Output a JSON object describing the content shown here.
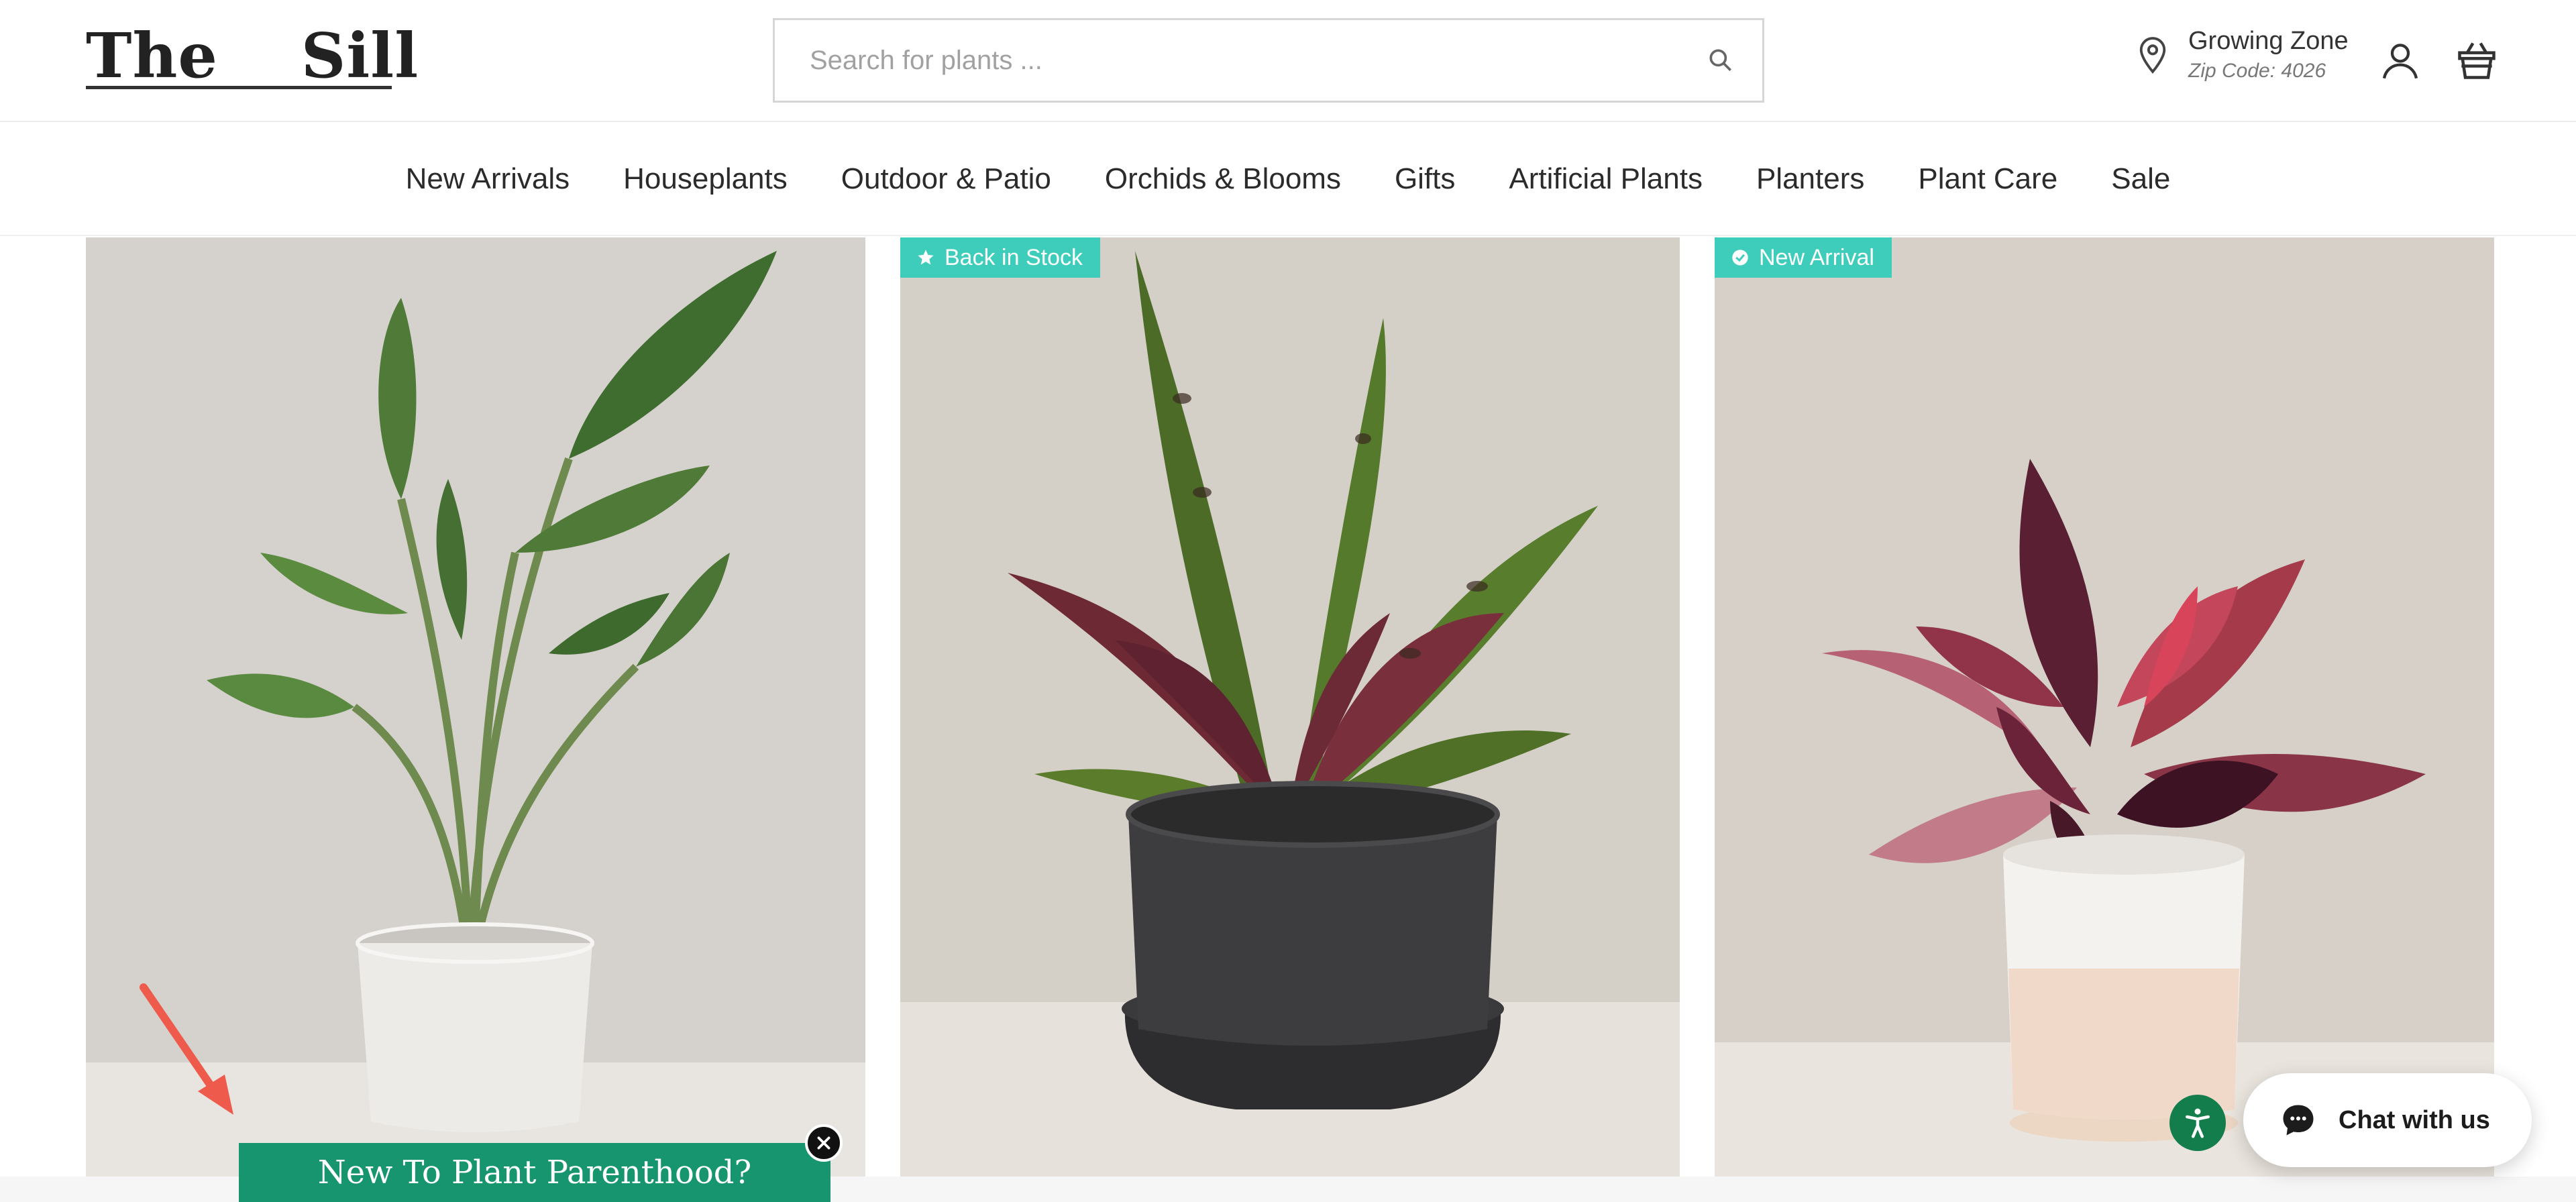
{
  "header": {
    "logo_left": "The",
    "logo_right": "Sill",
    "search_placeholder": "Search for plants ...",
    "zone_title": "Growing Zone",
    "zone_zip": "Zip Code: 4026"
  },
  "nav": {
    "items": [
      {
        "label": "New Arrivals"
      },
      {
        "label": "Houseplants"
      },
      {
        "label": "Outdoor & Patio"
      },
      {
        "label": "Orchids & Blooms"
      },
      {
        "label": "Gifts"
      },
      {
        "label": "Artificial Plants"
      },
      {
        "label": "Planters"
      },
      {
        "label": "Plant Care"
      },
      {
        "label": "Sale"
      }
    ]
  },
  "products": [
    {
      "badge": null,
      "pot_color": "#ecebe8",
      "wall_color": "#d5d2cd"
    },
    {
      "badge": "Back in Stock",
      "pot_color": "#3d3d3f",
      "wall_color": "#d4cfc7"
    },
    {
      "badge": "New Arrival",
      "pot_color": "#f4f2ef",
      "wall_color": "#d6d0c9"
    }
  ],
  "popup": {
    "label": "New To Plant Parenthood?"
  },
  "chat": {
    "label": "Chat with us"
  },
  "colors": {
    "badge": "#3ecdbb",
    "popup": "#17956f",
    "a11y": "#137d4c",
    "arrow": "#ee5a4b"
  },
  "icons": [
    "search-icon",
    "map-pin-icon",
    "account-icon",
    "cart-icon",
    "star-icon",
    "info-icon",
    "close-icon",
    "accessibility-icon",
    "chat-bubble-icon"
  ]
}
